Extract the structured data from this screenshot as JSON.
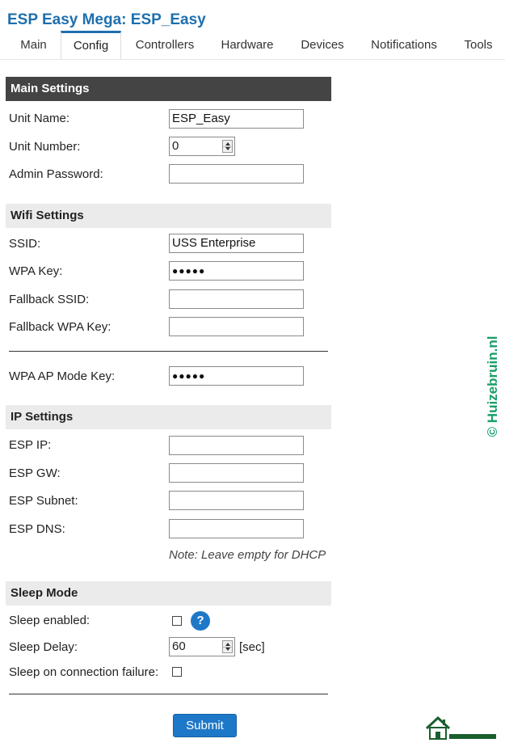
{
  "app": {
    "title": "ESP Easy Mega: ESP_Easy"
  },
  "tabs": [
    {
      "label": "Main"
    },
    {
      "label": "Config",
      "active": true
    },
    {
      "label": "Controllers"
    },
    {
      "label": "Hardware"
    },
    {
      "label": "Devices"
    },
    {
      "label": "Notifications"
    },
    {
      "label": "Tools"
    }
  ],
  "main_settings": {
    "header": "Main Settings",
    "unit_name_label": "Unit Name:",
    "unit_name_value": "ESP_Easy",
    "unit_number_label": "Unit Number:",
    "unit_number_value": "0",
    "admin_password_label": "Admin Password:",
    "admin_password_value": ""
  },
  "wifi_settings": {
    "header": "Wifi Settings",
    "ssid_label": "SSID:",
    "ssid_value": "USS Enterprise",
    "wpa_key_label": "WPA Key:",
    "wpa_key_value": "●●●●●",
    "fallback_ssid_label": "Fallback SSID:",
    "fallback_ssid_value": "",
    "fallback_wpa_label": "Fallback WPA Key:",
    "fallback_wpa_value": "",
    "ap_mode_key_label": "WPA AP Mode Key:",
    "ap_mode_key_value": "●●●●●"
  },
  "ip_settings": {
    "header": "IP Settings",
    "esp_ip_label": "ESP IP:",
    "esp_gw_label": "ESP GW:",
    "esp_subnet_label": "ESP Subnet:",
    "esp_dns_label": "ESP DNS:",
    "note": "Note: Leave empty for DHCP"
  },
  "sleep_mode": {
    "header": "Sleep Mode",
    "sleep_enabled_label": "Sleep enabled:",
    "sleep_enabled_checked": false,
    "help_glyph": "?",
    "sleep_delay_label": "Sleep Delay:",
    "sleep_delay_value": "60",
    "sleep_delay_unit": "[sec]",
    "sleep_on_failure_label": "Sleep on connection failure:",
    "sleep_on_failure_checked": false
  },
  "form": {
    "submit_label": "Submit"
  },
  "watermark": {
    "text": "© Huizebruin.nl",
    "logo_text": "huizebruin.nl"
  },
  "colors": {
    "accent": "#1e6fae",
    "button": "#1e78c8",
    "header_dark": "#444444",
    "section_bg": "#ebebeb",
    "watermark": "#1a9e6a"
  },
  "icons": {
    "help": "help-icon",
    "checkbox": "checkbox-icon",
    "spinner": "spinner-icon",
    "logo": "house-logo-icon"
  }
}
